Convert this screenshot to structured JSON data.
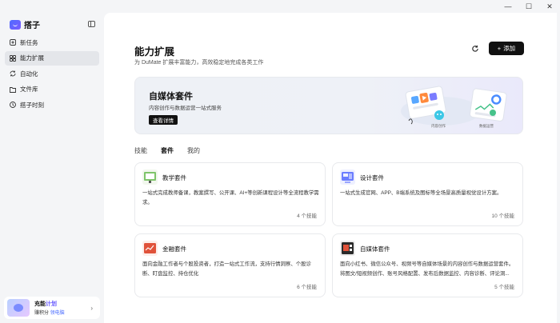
{
  "window": {
    "minimize": "—",
    "maximize": "☐",
    "close": "✕"
  },
  "sidebar": {
    "brand": "搭子",
    "items": [
      {
        "label": "新任务",
        "icon": "new-task-icon"
      },
      {
        "label": "能力扩展",
        "icon": "capability-icon",
        "active": true
      },
      {
        "label": "自动化",
        "icon": "automation-icon"
      },
      {
        "label": "文件库",
        "icon": "folder-icon"
      },
      {
        "label": "搭子时刻",
        "icon": "clock-icon"
      }
    ],
    "promo": {
      "title_a": "充能",
      "title_b": "计划",
      "sub_a": "赚积分 ",
      "sub_b": "领电脑"
    }
  },
  "main": {
    "title": "能力扩展",
    "subtitle": "为 DuMate 扩展丰富能力，高效稳定地完成各类工作",
    "add_button": "添加",
    "banner": {
      "title": "自媒体套件",
      "desc": "内容创作与数据运营一站式服务",
      "button": "查看详情",
      "art_label_1": "内容创作",
      "art_label_2": "数据运营"
    },
    "tabs": [
      {
        "label": "技能"
      },
      {
        "label": "套件",
        "active": true
      },
      {
        "label": "我的"
      }
    ],
    "cards": [
      {
        "name": "教学套件",
        "desc": "一站式完成教师备课，教案撰写、公开课、AI+等创新课程设计等全流程教学需求。",
        "count": "4 个技能",
        "color": "#7ec46a"
      },
      {
        "name": "设计套件",
        "desc": "一站式生成官网、APP、B端系统及图标等全场景高质量视觉设计方案。",
        "count": "10 个技能",
        "color": "#6b7dff"
      },
      {
        "name": "金融套件",
        "desc": "面向金融工作者与个股投资者，打造一站式工作流，支持行情洞察、个股诊断、盯盘监控、持仓优化",
        "count": "6 个技能",
        "color": "#e0523a"
      },
      {
        "name": "自媒体套件",
        "desc": "面向小红书、微信公众号、视频号等自媒体场景的内容创作与数据运营套件。将图文/短视频创作、账号风格配置、发布后数据监控、内容诊断、评论洞...",
        "count": "5 个技能",
        "color": "#2a2a2a"
      }
    ]
  }
}
